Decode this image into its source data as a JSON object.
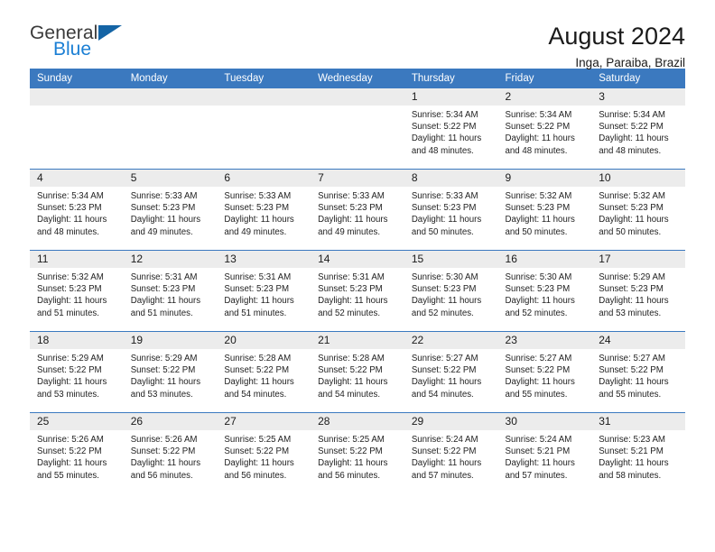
{
  "brand": {
    "name_part1": "General",
    "name_part2": "Blue",
    "triangle_icon": "triangle-icon",
    "accent_color": "#1b7fd4",
    "header_color": "#3b79bf"
  },
  "header": {
    "title": "August 2024",
    "subtitle": "Inga, Paraiba, Brazil"
  },
  "calendar": {
    "weekday_headers": [
      "Sunday",
      "Monday",
      "Tuesday",
      "Wednesday",
      "Thursday",
      "Friday",
      "Saturday"
    ],
    "labels": {
      "sunrise": "Sunrise:",
      "sunset": "Sunset:",
      "daylight": "Daylight:"
    },
    "weeks": [
      [
        {
          "day": "",
          "info": ""
        },
        {
          "day": "",
          "info": ""
        },
        {
          "day": "",
          "info": ""
        },
        {
          "day": "",
          "info": ""
        },
        {
          "day": "1",
          "info": "Sunrise: 5:34 AM\nSunset: 5:22 PM\nDaylight: 11 hours\nand 48 minutes."
        },
        {
          "day": "2",
          "info": "Sunrise: 5:34 AM\nSunset: 5:22 PM\nDaylight: 11 hours\nand 48 minutes."
        },
        {
          "day": "3",
          "info": "Sunrise: 5:34 AM\nSunset: 5:22 PM\nDaylight: 11 hours\nand 48 minutes."
        }
      ],
      [
        {
          "day": "4",
          "info": "Sunrise: 5:34 AM\nSunset: 5:23 PM\nDaylight: 11 hours\nand 48 minutes."
        },
        {
          "day": "5",
          "info": "Sunrise: 5:33 AM\nSunset: 5:23 PM\nDaylight: 11 hours\nand 49 minutes."
        },
        {
          "day": "6",
          "info": "Sunrise: 5:33 AM\nSunset: 5:23 PM\nDaylight: 11 hours\nand 49 minutes."
        },
        {
          "day": "7",
          "info": "Sunrise: 5:33 AM\nSunset: 5:23 PM\nDaylight: 11 hours\nand 49 minutes."
        },
        {
          "day": "8",
          "info": "Sunrise: 5:33 AM\nSunset: 5:23 PM\nDaylight: 11 hours\nand 50 minutes."
        },
        {
          "day": "9",
          "info": "Sunrise: 5:32 AM\nSunset: 5:23 PM\nDaylight: 11 hours\nand 50 minutes."
        },
        {
          "day": "10",
          "info": "Sunrise: 5:32 AM\nSunset: 5:23 PM\nDaylight: 11 hours\nand 50 minutes."
        }
      ],
      [
        {
          "day": "11",
          "info": "Sunrise: 5:32 AM\nSunset: 5:23 PM\nDaylight: 11 hours\nand 51 minutes."
        },
        {
          "day": "12",
          "info": "Sunrise: 5:31 AM\nSunset: 5:23 PM\nDaylight: 11 hours\nand 51 minutes."
        },
        {
          "day": "13",
          "info": "Sunrise: 5:31 AM\nSunset: 5:23 PM\nDaylight: 11 hours\nand 51 minutes."
        },
        {
          "day": "14",
          "info": "Sunrise: 5:31 AM\nSunset: 5:23 PM\nDaylight: 11 hours\nand 52 minutes."
        },
        {
          "day": "15",
          "info": "Sunrise: 5:30 AM\nSunset: 5:23 PM\nDaylight: 11 hours\nand 52 minutes."
        },
        {
          "day": "16",
          "info": "Sunrise: 5:30 AM\nSunset: 5:23 PM\nDaylight: 11 hours\nand 52 minutes."
        },
        {
          "day": "17",
          "info": "Sunrise: 5:29 AM\nSunset: 5:23 PM\nDaylight: 11 hours\nand 53 minutes."
        }
      ],
      [
        {
          "day": "18",
          "info": "Sunrise: 5:29 AM\nSunset: 5:22 PM\nDaylight: 11 hours\nand 53 minutes."
        },
        {
          "day": "19",
          "info": "Sunrise: 5:29 AM\nSunset: 5:22 PM\nDaylight: 11 hours\nand 53 minutes."
        },
        {
          "day": "20",
          "info": "Sunrise: 5:28 AM\nSunset: 5:22 PM\nDaylight: 11 hours\nand 54 minutes."
        },
        {
          "day": "21",
          "info": "Sunrise: 5:28 AM\nSunset: 5:22 PM\nDaylight: 11 hours\nand 54 minutes."
        },
        {
          "day": "22",
          "info": "Sunrise: 5:27 AM\nSunset: 5:22 PM\nDaylight: 11 hours\nand 54 minutes."
        },
        {
          "day": "23",
          "info": "Sunrise: 5:27 AM\nSunset: 5:22 PM\nDaylight: 11 hours\nand 55 minutes."
        },
        {
          "day": "24",
          "info": "Sunrise: 5:27 AM\nSunset: 5:22 PM\nDaylight: 11 hours\nand 55 minutes."
        }
      ],
      [
        {
          "day": "25",
          "info": "Sunrise: 5:26 AM\nSunset: 5:22 PM\nDaylight: 11 hours\nand 55 minutes."
        },
        {
          "day": "26",
          "info": "Sunrise: 5:26 AM\nSunset: 5:22 PM\nDaylight: 11 hours\nand 56 minutes."
        },
        {
          "day": "27",
          "info": "Sunrise: 5:25 AM\nSunset: 5:22 PM\nDaylight: 11 hours\nand 56 minutes."
        },
        {
          "day": "28",
          "info": "Sunrise: 5:25 AM\nSunset: 5:22 PM\nDaylight: 11 hours\nand 56 minutes."
        },
        {
          "day": "29",
          "info": "Sunrise: 5:24 AM\nSunset: 5:22 PM\nDaylight: 11 hours\nand 57 minutes."
        },
        {
          "day": "30",
          "info": "Sunrise: 5:24 AM\nSunset: 5:21 PM\nDaylight: 11 hours\nand 57 minutes."
        },
        {
          "day": "31",
          "info": "Sunrise: 5:23 AM\nSunset: 5:21 PM\nDaylight: 11 hours\nand 58 minutes."
        }
      ]
    ]
  }
}
